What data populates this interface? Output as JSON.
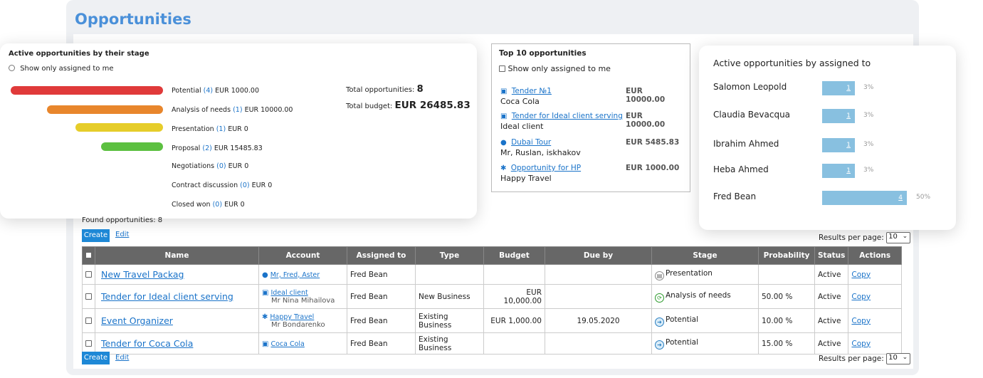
{
  "page_title": "Opportunities",
  "stage_card": {
    "title": "Active opportunities by their stage",
    "radio_label": "Show only assigned to me",
    "colors": {
      "potential": "#e03a3a",
      "analysis": "#e8862c",
      "presentation": "#e6cd2a",
      "proposal": "#5cc040"
    },
    "stages": [
      {
        "name": "Potential",
        "count": "(4)",
        "amount": "EUR 1000.00"
      },
      {
        "name": "Analysis of needs",
        "count": "(1)",
        "amount": "EUR 10000.00"
      },
      {
        "name": "Presentation",
        "count": "(1)",
        "amount": "EUR 0"
      },
      {
        "name": "Proposal",
        "count": "(2)",
        "amount": "EUR 15485.83"
      },
      {
        "name": "Negotiations",
        "count": "(0)",
        "amount": "EUR 0"
      },
      {
        "name": "Contract discussion",
        "count": "(0)",
        "amount": "EUR 0"
      },
      {
        "name": "Closed won",
        "count": "(0)",
        "amount": "EUR 0"
      }
    ],
    "total_opps_label": "Total opportunities:",
    "total_opps_value": "8",
    "total_budget_label": "Total budget:",
    "total_budget_value": "EUR 26485.83"
  },
  "top10": {
    "title": "Top 10 opportunities",
    "checkbox_label": "Show only assigned to me",
    "items": [
      {
        "name": "Tender №1",
        "amount": "EUR 10000.00",
        "sub": "Coca Cola",
        "icon": "briefcase-icon"
      },
      {
        "name": "Tender for Ideal client serving",
        "amount": "EUR 10000.00",
        "sub": "Ideal client",
        "icon": "briefcase-icon"
      },
      {
        "name": "Dubai Tour",
        "amount": "EUR 5485.83",
        "sub": "Mr, Ruslan, iskhakov",
        "icon": "person-icon"
      },
      {
        "name": "Opportunity for HP",
        "amount": "EUR 1000.00",
        "sub": "Happy Travel",
        "icon": "group-icon"
      }
    ]
  },
  "assigned_card": {
    "title": "Active opportunities by assigned to",
    "rows": [
      {
        "name": "Salomon Leopold",
        "count": "1",
        "pct": "3%"
      },
      {
        "name": "Claudia Bevacqua",
        "count": "1",
        "pct": "3%"
      },
      {
        "name": "Ibrahim Ahmed",
        "count": "1",
        "pct": "3%"
      },
      {
        "name": "Heba Ahmed",
        "count": "1",
        "pct": "3%"
      },
      {
        "name": "Fred Bean",
        "count": "4",
        "pct": "50%"
      }
    ]
  },
  "list": {
    "found_label": "Found opportunities: 8",
    "create_label": "Create",
    "edit_label": "Edit",
    "results_per_page_label": "Results per page:",
    "results_per_page_value": "10",
    "columns": [
      "Name",
      "Account",
      "Assigned to",
      "Type",
      "Budget",
      "Due by",
      "Stage",
      "Probability",
      "Status",
      "Actions"
    ],
    "rows": [
      {
        "name": "New Travel Packag",
        "account": "Mr, Fred, Aster",
        "account_sub": "",
        "account_icon": "person-icon",
        "assigned": "Fred Bean",
        "type": "",
        "budget": "",
        "due": "",
        "stage": "Presentation",
        "stage_icon": "presentation-icon",
        "probability": "",
        "status": "Active",
        "action": "Copy"
      },
      {
        "name": "Tender for Ideal client serving",
        "account": "Ideal client",
        "account_sub": "Mr Nina Mihailova",
        "account_icon": "briefcase-icon",
        "assigned": "Fred Bean",
        "type": "New Business",
        "budget": "EUR 10,000.00",
        "due": "",
        "stage": "Analysis of needs",
        "stage_icon": "analysis-icon",
        "probability": "50.00 %",
        "status": "Active",
        "action": "Copy"
      },
      {
        "name": "Event Organizer",
        "account": "Happy Travel",
        "account_sub": "Mr Bondarenko",
        "account_icon": "group-icon",
        "assigned": "Fred Bean",
        "type": "Existing Business",
        "budget": "EUR 1,000.00",
        "due": "19.05.2020",
        "stage": "Potential",
        "stage_icon": "potential-icon",
        "probability": "10.00 %",
        "status": "Active",
        "action": "Copy"
      },
      {
        "name": "Tender for Coca Cola",
        "account": "Coca Cola",
        "account_sub": "",
        "account_icon": "briefcase-icon",
        "assigned": "Fred Bean",
        "type": "Existing Business",
        "budget": "",
        "due": "",
        "stage": "Potential",
        "stage_icon": "potential-icon",
        "probability": "15.00 %",
        "status": "Active",
        "action": "Copy"
      }
    ]
  }
}
